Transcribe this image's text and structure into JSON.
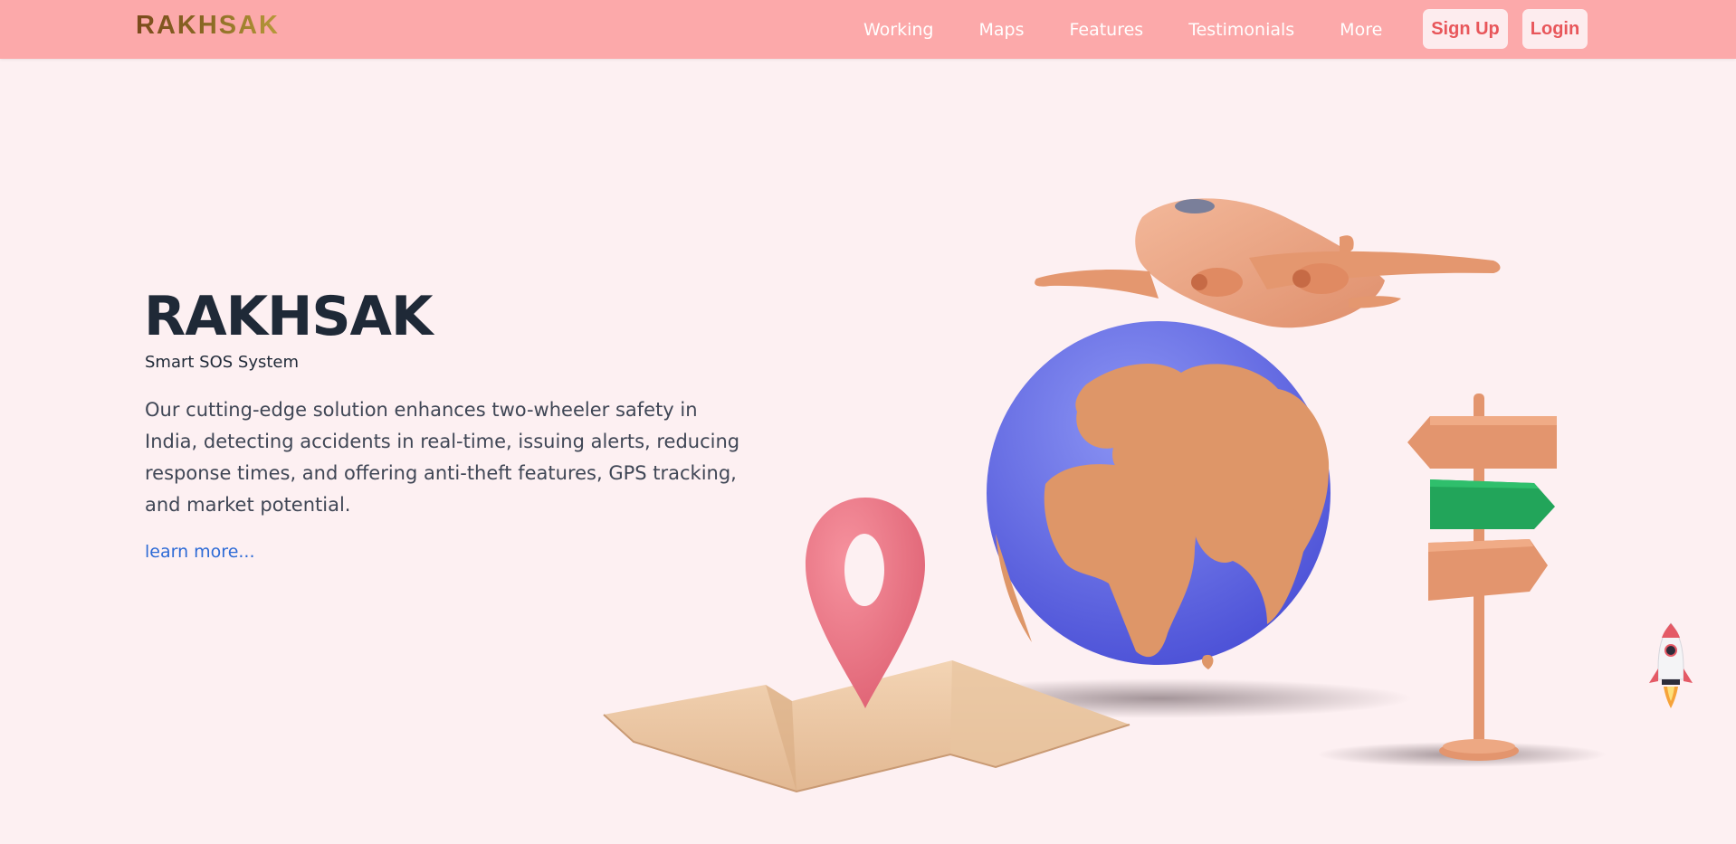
{
  "brand": {
    "logo": "RAKHSAK"
  },
  "nav": {
    "links": [
      "Working",
      "Maps",
      "Features",
      "Testimonials",
      "More"
    ],
    "signup_label": "Sign Up",
    "login_label": "Login"
  },
  "hero": {
    "title": "RAKHSAK",
    "subtitle": "Smart SOS System",
    "description": "Our cutting-edge solution enhances two-wheeler safety in India, detecting accidents in real-time, issuing alerts, reducing response times, and offering anti-theft features, GPS tracking, and market potential.",
    "learn_more": "learn more..."
  },
  "icons": {
    "illustration": "travel-scene-illustration",
    "scroll_top": "rocket-icon"
  },
  "colors": {
    "navbar": "#fca9aa",
    "page_background": "#fdf0f2",
    "button_text": "#e8565a",
    "link": "#2e6bd6",
    "title": "#1f2937"
  }
}
